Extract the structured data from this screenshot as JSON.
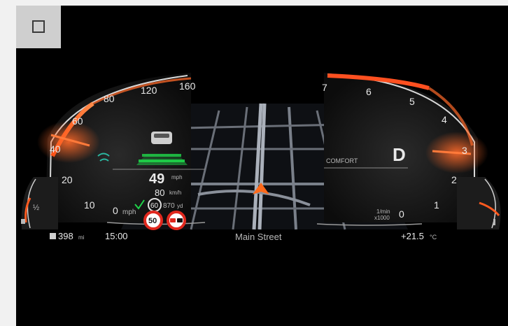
{
  "checkbox": {
    "checked": false
  },
  "speedometer": {
    "ticks": [
      "0",
      "20",
      "40",
      "60",
      "80",
      "120",
      "160"
    ],
    "unit": "mph"
  },
  "tachometer": {
    "ticks": [
      "0",
      "1",
      "2",
      "3",
      "4",
      "5",
      "6",
      "7"
    ],
    "unit_top": "1/min",
    "unit_bottom": "x1000"
  },
  "assist": {
    "speed_mph": "49",
    "speed_mph_unit": "mph",
    "speed_kmh": "80",
    "speed_kmh_unit": "km/h",
    "limit_set": "60",
    "limit_secondary": "870",
    "limit_secondary_unit": "yd"
  },
  "signs": {
    "speed_limit": "50"
  },
  "fuel_gauge": {
    "mid_label": "½"
  },
  "drive": {
    "mode": "COMFORT",
    "gear": "D"
  },
  "status_bar": {
    "range": "398",
    "range_unit": "mi",
    "clock": "15:00",
    "street": "Main Street",
    "temperature": "+21.5",
    "temperature_unit": "°C"
  },
  "colors": {
    "accent": "#ff5a1f",
    "assist_green": "#1fd64a",
    "background": "#000000"
  },
  "icons": [
    "car-icon",
    "lane-assist-icon",
    "navigation-arrow-icon",
    "no-overtaking-sign-icon",
    "fuel-icon",
    "temperature-icon"
  ]
}
